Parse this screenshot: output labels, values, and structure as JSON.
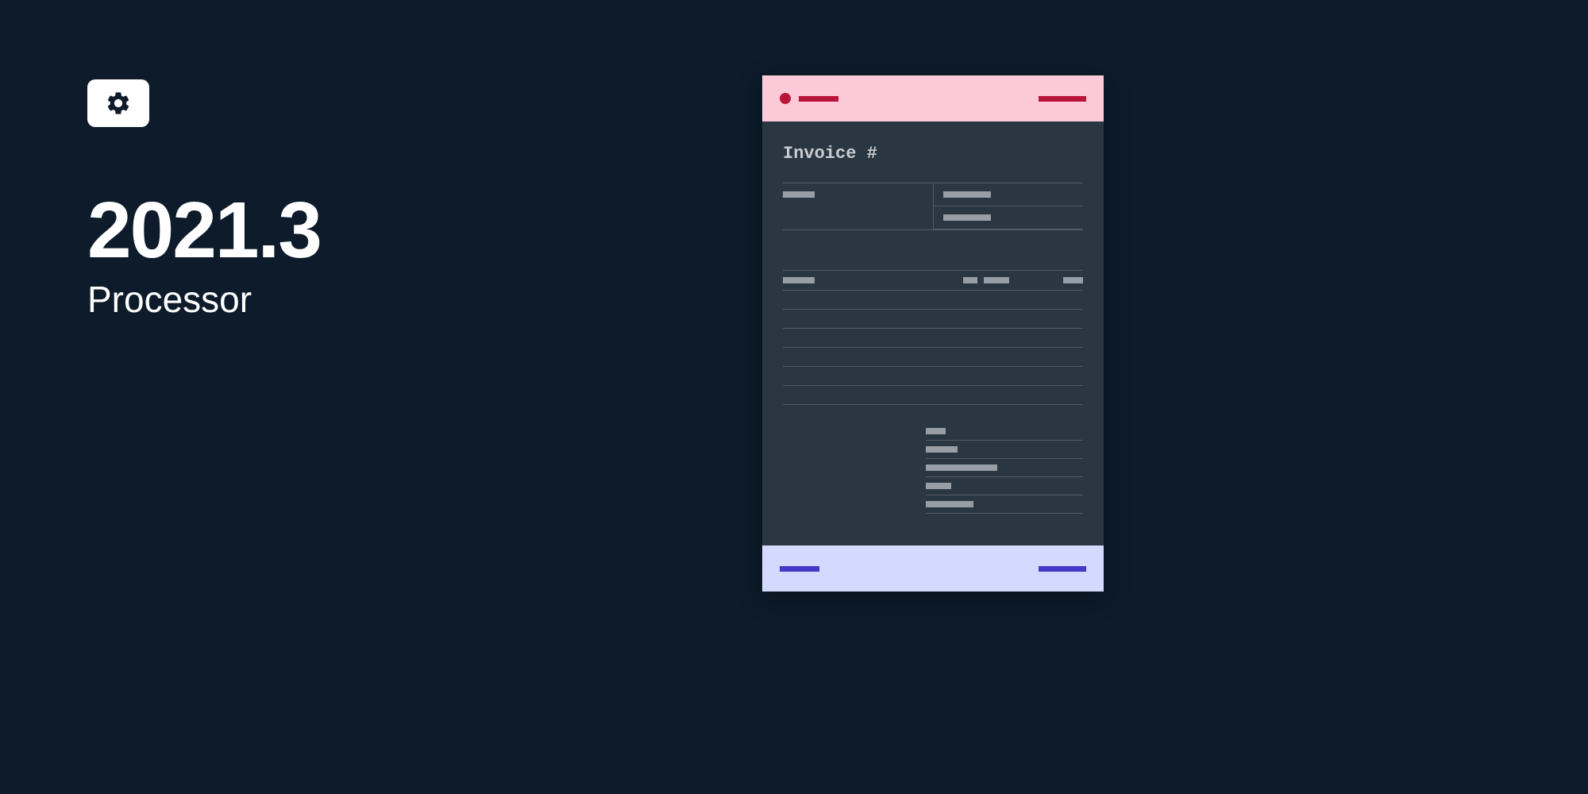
{
  "header": {
    "version": "2021.3",
    "product": "Processor"
  },
  "invoice": {
    "title": "Invoice #"
  },
  "colors": {
    "bg": "#0d1b2a",
    "card": "#2a3642",
    "header_pink": "#fcc9d9",
    "footer_lilac": "#d4daff",
    "red": "#b91539",
    "blue": "#4338ca",
    "gray": "#979ea5"
  }
}
